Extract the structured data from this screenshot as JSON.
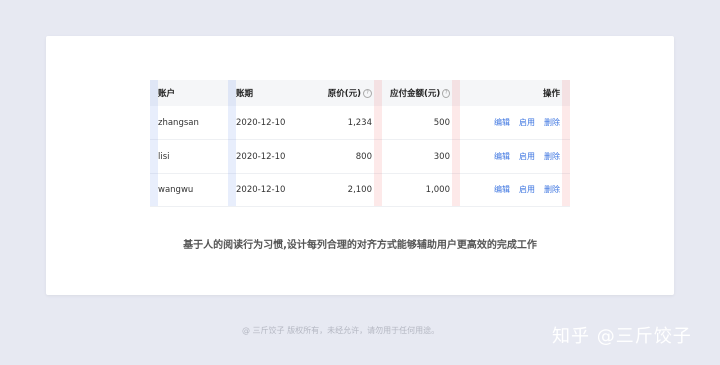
{
  "table": {
    "headers": {
      "account": "账户",
      "period": "账期",
      "price": "原价(元)",
      "amount": "应付金额(元)",
      "actions": "操作"
    },
    "rows": [
      {
        "account": "zhangsan",
        "period": "2020-12-10",
        "price": "1,234",
        "amount": "500"
      },
      {
        "account": "lisi",
        "period": "2020-12-10",
        "price": "800",
        "amount": "300"
      },
      {
        "account": "wangwu",
        "period": "2020-12-10",
        "price": "2,100",
        "amount": "1,000"
      }
    ],
    "actions": {
      "edit": "编辑",
      "enable": "启用",
      "delete": "删除"
    },
    "help_glyph": "?"
  },
  "caption": "基于人的阅读行为习惯,设计每列合理的对齐方式能够辅助用户更高效的完成工作",
  "footer": {
    "copyright": "@ 三斤饺子  版权所有，未经允许，请勿用于任何用途。",
    "watermark": "知乎 @三斤饺子"
  },
  "colors": {
    "background": "#e7e9f2",
    "accent": "#3a73e0",
    "guide_blue": "#dbe4fb",
    "guide_red": "#fbe1e1"
  }
}
